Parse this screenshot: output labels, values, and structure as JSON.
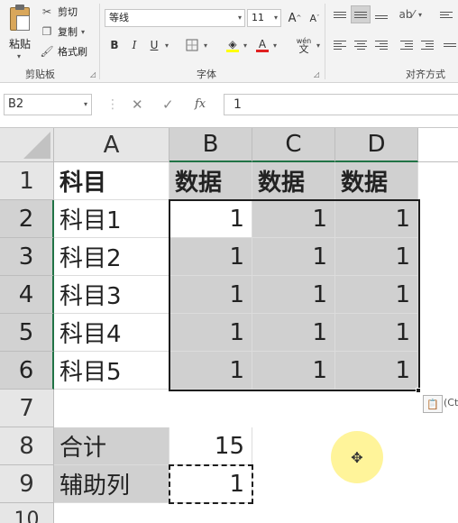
{
  "ribbon": {
    "clipboard": {
      "paste_label": "粘贴",
      "cut_label": "剪切",
      "copy_label": "复制",
      "format_painter_label": "格式刷",
      "group_label": "剪贴板"
    },
    "font": {
      "font_name": "等线",
      "font_size": "11",
      "bold": "B",
      "italic": "I",
      "underline": "U",
      "grow": "A",
      "shrink": "A",
      "font_color_glyph": "A",
      "phonetic": "wén",
      "group_label": "字体"
    },
    "alignment": {
      "group_label": "对齐方式"
    }
  },
  "formula_bar": {
    "name_box": "B2",
    "cancel": "✕",
    "enter": "✓",
    "fx": "fx",
    "value": "1"
  },
  "grid": {
    "columns": [
      "A",
      "B",
      "C",
      "D"
    ],
    "rows": [
      "1",
      "2",
      "3",
      "4",
      "5",
      "6",
      "7",
      "8",
      "9",
      "10"
    ],
    "header_row": [
      "科目",
      "数据",
      "数据",
      "数据"
    ],
    "data_rows": [
      {
        "label": "科目1",
        "values": [
          "1",
          "1",
          "1"
        ]
      },
      {
        "label": "科目2",
        "values": [
          "1",
          "1",
          "1"
        ]
      },
      {
        "label": "科目3",
        "values": [
          "1",
          "1",
          "1"
        ]
      },
      {
        "label": "科目4",
        "values": [
          "1",
          "1",
          "1"
        ]
      },
      {
        "label": "科目5",
        "values": [
          "1",
          "1",
          "1"
        ]
      }
    ],
    "total_label": "合计",
    "total_value": "15",
    "helper_label": "辅助列",
    "helper_value": "1",
    "paste_options_label": "(Ct"
  }
}
